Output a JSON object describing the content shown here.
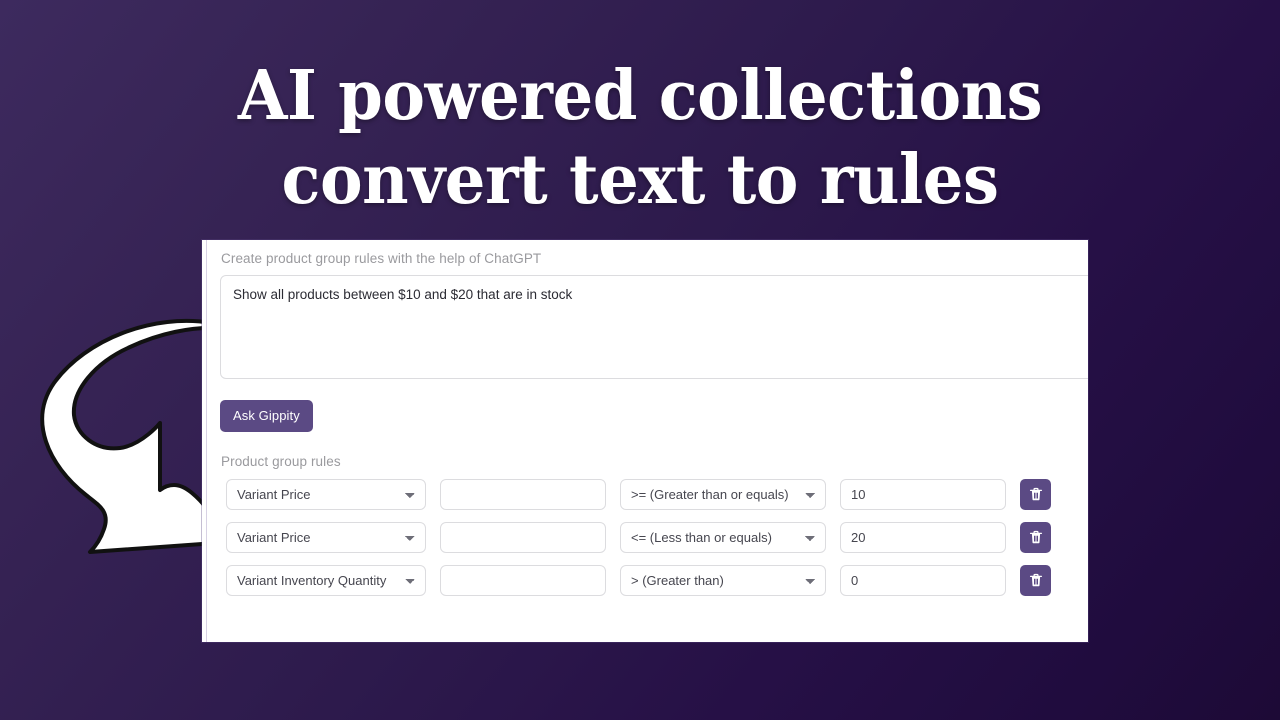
{
  "theme": {
    "bg_gradient_from": "#3d2a5e",
    "bg_gradient_to": "#1d0a36",
    "accent_purple": "#5b4a84",
    "card_bg": "#ffffff",
    "label_gray": "#9a9a9e",
    "border_gray": "#dcdcdf",
    "headline_color": "#ffffff"
  },
  "headline": {
    "text": "AI powered collections\nconvert text to rules"
  },
  "card": {
    "prompt": {
      "label": "Create product group rules with the help of ChatGPT",
      "value": "Show all products between $10 and $20 that are in stock",
      "placeholder": ""
    },
    "ask_button": {
      "label": "Ask Gippity"
    },
    "rules_section": {
      "label": "Product group rules",
      "columns": [
        "field",
        "relation",
        "operator",
        "value",
        "delete"
      ],
      "field_options": [
        "Variant Price",
        "Variant Inventory Quantity"
      ],
      "operator_options": [
        ">= (Greater than or equals)",
        "<= (Less than or equals)",
        "> (Greater than)"
      ],
      "rows": [
        {
          "field": "Variant Price",
          "relation": "",
          "relation_placeholder": "",
          "operator": ">= (Greater than or equals)",
          "value": "10",
          "delete_icon": "trash-icon"
        },
        {
          "field": "Variant Price",
          "relation": "",
          "relation_placeholder": "",
          "operator": "<= (Less than or equals)",
          "value": "20",
          "delete_icon": "trash-icon"
        },
        {
          "field": "Variant Inventory Quantity",
          "relation": "",
          "relation_placeholder": "",
          "operator": "> (Greater than)",
          "value": "0",
          "delete_icon": "trash-icon"
        }
      ]
    }
  },
  "annotation": {
    "arrow_icon": "curved-arrow-pointing-down-right"
  }
}
